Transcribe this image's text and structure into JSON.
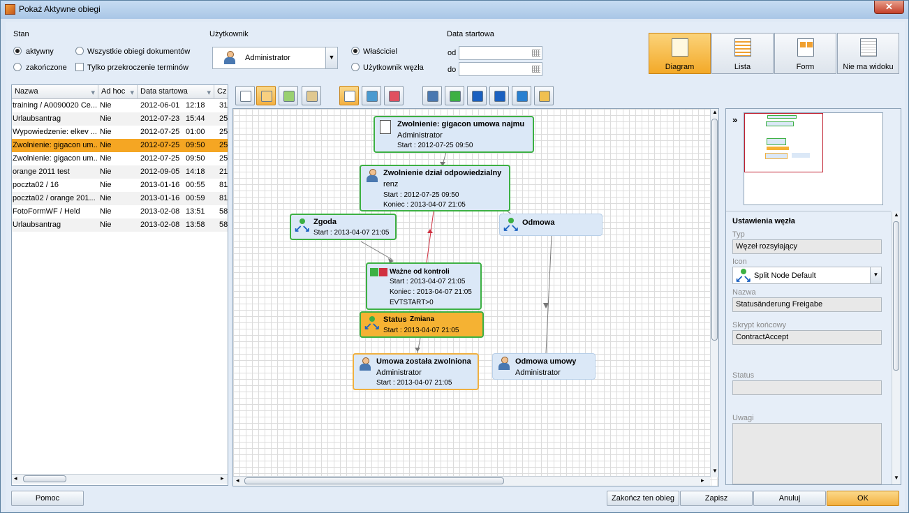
{
  "window": {
    "title": "Pokaż Aktywne obiegi",
    "close_label": "✕"
  },
  "filters": {
    "stan": {
      "label": "Stan",
      "opt_active": "aktywny",
      "opt_all": "Wszystkie obiegi dokumentów",
      "opt_finished": "zakończone",
      "opt_overdue": "Tylko przekroczenie terminów"
    },
    "user": {
      "label": "Użytkownik",
      "value": "Administrator",
      "opt_owner": "Właściciel",
      "opt_node_user": "Użytkownik węzła"
    },
    "start": {
      "label": "Data startowa",
      "from_label": "od",
      "to_label": "do"
    }
  },
  "views": [
    {
      "label": "Diagram",
      "icon": "diagram-icon"
    },
    {
      "label": "Lista",
      "icon": "list-icon"
    },
    {
      "label": "Form",
      "icon": "form-icon"
    },
    {
      "label": "Nie ma widoku",
      "icon": "no-view-icon"
    }
  ],
  "list": {
    "columns": [
      "Nazwa",
      "Ad hoc",
      "Data startowa",
      "Cz"
    ],
    "rows": [
      {
        "name": "training / A0090020 Ce...",
        "adhoc": "Nie",
        "date": "2012-06-01",
        "time": "12:18",
        "c": "31"
      },
      {
        "name": "Urlaubsantrag",
        "adhoc": "Nie",
        "date": "2012-07-23",
        "time": "15:44",
        "c": "25"
      },
      {
        "name": "Wypowiedzenie: elkev ...",
        "adhoc": "Nie",
        "date": "2012-07-25",
        "time": "01:00",
        "c": "25"
      },
      {
        "name": "Zwolnienie: gigacon um...",
        "adhoc": "Nie",
        "date": "2012-07-25",
        "time": "09:50",
        "c": "25"
      },
      {
        "name": "Zwolnienie: gigacon um...",
        "adhoc": "Nie",
        "date": "2012-07-25",
        "time": "09:50",
        "c": "25"
      },
      {
        "name": "orange 2011 test",
        "adhoc": "Nie",
        "date": "2012-09-05",
        "time": "14:18",
        "c": "21"
      },
      {
        "name": "poczta02 / 16",
        "adhoc": "Nie",
        "date": "2013-01-16",
        "time": "00:55",
        "c": "81"
      },
      {
        "name": "poczta02 / orange 201...",
        "adhoc": "Nie",
        "date": "2013-01-16",
        "time": "00:59",
        "c": "81"
      },
      {
        "name": "FotoFormWF / Held",
        "adhoc": "Nie",
        "date": "2013-02-08",
        "time": "13:51",
        "c": "58"
      },
      {
        "name": "Urlaubsantrag",
        "adhoc": "Nie",
        "date": "2013-02-08",
        "time": "13:58",
        "c": "58"
      }
    ]
  },
  "toolbar": [
    "layout-icon",
    "grid-icon",
    "nodes-icon",
    "edit-icon",
    "pointer-icon",
    "connector-icon",
    "eraser-icon",
    "user-node-icon",
    "condition-node-icon",
    "split-node-icon",
    "join-node-icon",
    "loop-node-icon",
    "script-node-icon"
  ],
  "diagram": {
    "n1": {
      "title": "Zwolnienie: gigacon umowa najmu",
      "l1": "Administrator",
      "l2": "Start : 2012-07-25 09:50"
    },
    "n2": {
      "title": "Zwolnienie dział odpowiedzialny",
      "l1": "renz",
      "l2": "Start : 2012-07-25 09:50",
      "l3": "Koniec : 2013-04-07 21:05"
    },
    "n3": {
      "title": "Zgoda",
      "l1": "Start : 2013-04-07 21:05"
    },
    "n4": {
      "title": "Odmowa"
    },
    "n5": {
      "title": "Ważne od kontroli",
      "l1": "Start : 2013-04-07 21:05",
      "l2": "Koniec : 2013-04-07 21:05",
      "l3": "EVTSTART>0"
    },
    "n6": {
      "title": "Status",
      "title2": "Zmiana",
      "l1": "Start : 2013-04-07 21:05"
    },
    "n7": {
      "title": "Umowa została zwolniona",
      "l1": "Administrator",
      "l2": "Start : 2013-04-07 21:05"
    },
    "n8": {
      "title": "Odmowa umowy",
      "l1": "Administrator"
    }
  },
  "properties": {
    "header": "Ustawienia węzła",
    "collapse": "»",
    "type_label": "Typ",
    "type_value": "Węzeł rozsyłający",
    "icon_label": "Icon",
    "icon_value": "Split Node Default",
    "name_label": "Nazwa",
    "name_value": "Statusänderung Freigabe",
    "script_label": "Skrypt końcowy",
    "script_value": "ContractAccept",
    "status_label": "Status",
    "status_value": "",
    "notes_label": "Uwagi",
    "notes_value": ""
  },
  "buttons": {
    "help": "Pomoc",
    "finish": "Zakończ ten obieg",
    "save": "Zapisz",
    "cancel": "Anuluj",
    "ok": "OK"
  },
  "colors": {
    "accent": "#f5a623",
    "node_border": "#3cb043",
    "node_fill": "#dbe8f7"
  }
}
